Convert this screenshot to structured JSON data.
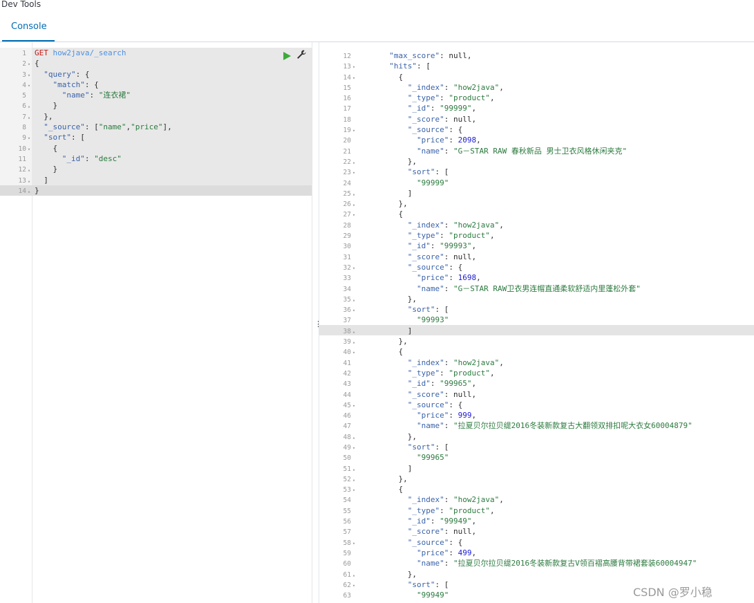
{
  "app": {
    "title": "Dev Tools"
  },
  "tabs": [
    {
      "label": "Console"
    }
  ],
  "request": {
    "lines": [
      {
        "n": "1",
        "fold": "",
        "html": "<span class=\"m\">GET</span> <span class=\"u\">how2java/_search</span>"
      },
      {
        "n": "2",
        "fold": "▾",
        "html": "{"
      },
      {
        "n": "3",
        "fold": "▾",
        "html": "  <span class=\"k\">\"query\"</span>: {"
      },
      {
        "n": "4",
        "fold": "▾",
        "html": "    <span class=\"k\">\"match\"</span>: {"
      },
      {
        "n": "5",
        "fold": "",
        "html": "      <span class=\"k\">\"name\"</span>: <span class=\"s\">\"连衣裙\"</span>"
      },
      {
        "n": "6",
        "fold": "▴",
        "html": "    }"
      },
      {
        "n": "7",
        "fold": "▴",
        "html": "  },"
      },
      {
        "n": "8",
        "fold": "",
        "html": "  <span class=\"k\">\"_source\"</span>: [<span class=\"s\">\"name\"</span>,<span class=\"s\">\"price\"</span>],"
      },
      {
        "n": "9",
        "fold": "▾",
        "html": "  <span class=\"k\">\"sort\"</span>: ["
      },
      {
        "n": "10",
        "fold": "▾",
        "html": "    {"
      },
      {
        "n": "11",
        "fold": "",
        "html": "      <span class=\"k\">\"_id\"</span>: <span class=\"s\">\"desc\"</span>"
      },
      {
        "n": "12",
        "fold": "▴",
        "html": "    }"
      },
      {
        "n": "13",
        "fold": "▴",
        "html": "  ]"
      },
      {
        "n": "14",
        "fold": "▴",
        "html": "}"
      }
    ]
  },
  "response": {
    "lines": [
      {
        "n": "12",
        "fold": "",
        "html": "  <span class=\"k\">\"max_score\"</span>: null,"
      },
      {
        "n": "13",
        "fold": "▾",
        "html": "  <span class=\"k\">\"hits\"</span>: ["
      },
      {
        "n": "14",
        "fold": "▾",
        "html": "    {"
      },
      {
        "n": "15",
        "fold": "",
        "html": "      <span class=\"k\">\"_index\"</span>: <span class=\"s\">\"how2java\"</span>,"
      },
      {
        "n": "16",
        "fold": "",
        "html": "      <span class=\"k\">\"_type\"</span>: <span class=\"s\">\"product\"</span>,"
      },
      {
        "n": "17",
        "fold": "",
        "html": "      <span class=\"k\">\"_id\"</span>: <span class=\"s\">\"99999\"</span>,"
      },
      {
        "n": "18",
        "fold": "",
        "html": "      <span class=\"k\">\"_score\"</span>: null,"
      },
      {
        "n": "19",
        "fold": "▾",
        "html": "      <span class=\"k\">\"_source\"</span>: {"
      },
      {
        "n": "20",
        "fold": "",
        "html": "        <span class=\"k\">\"price\"</span>: <span class=\"n\">2098</span>,"
      },
      {
        "n": "21",
        "fold": "",
        "html": "        <span class=\"k\">\"name\"</span>: <span class=\"s\">\"G－STAR RAW 春秋新品 男士卫衣风格休闲夹克\"</span>"
      },
      {
        "n": "22",
        "fold": "▴",
        "html": "      },"
      },
      {
        "n": "23",
        "fold": "▾",
        "html": "      <span class=\"k\">\"sort\"</span>: ["
      },
      {
        "n": "24",
        "fold": "",
        "html": "        <span class=\"s\">\"99999\"</span>"
      },
      {
        "n": "25",
        "fold": "▴",
        "html": "      ]"
      },
      {
        "n": "26",
        "fold": "▴",
        "html": "    },"
      },
      {
        "n": "27",
        "fold": "▾",
        "html": "    {"
      },
      {
        "n": "28",
        "fold": "",
        "html": "      <span class=\"k\">\"_index\"</span>: <span class=\"s\">\"how2java\"</span>,"
      },
      {
        "n": "29",
        "fold": "",
        "html": "      <span class=\"k\">\"_type\"</span>: <span class=\"s\">\"product\"</span>,"
      },
      {
        "n": "30",
        "fold": "",
        "html": "      <span class=\"k\">\"_id\"</span>: <span class=\"s\">\"99993\"</span>,"
      },
      {
        "n": "31",
        "fold": "",
        "html": "      <span class=\"k\">\"_score\"</span>: null,"
      },
      {
        "n": "32",
        "fold": "▾",
        "html": "      <span class=\"k\">\"_source\"</span>: {"
      },
      {
        "n": "33",
        "fold": "",
        "html": "        <span class=\"k\">\"price\"</span>: <span class=\"n\">1698</span>,"
      },
      {
        "n": "34",
        "fold": "",
        "html": "        <span class=\"k\">\"name\"</span>: <span class=\"s\">\"G－STAR RAW卫衣男连帽直通柔软舒适内里蓬松外套\"</span>"
      },
      {
        "n": "35",
        "fold": "▴",
        "html": "      },"
      },
      {
        "n": "36",
        "fold": "▾",
        "html": "      <span class=\"k\">\"sort\"</span>: ["
      },
      {
        "n": "37",
        "fold": "",
        "html": "        <span class=\"s\">\"99993\"</span>"
      },
      {
        "n": "38",
        "fold": "▴",
        "html": "      ]"
      },
      {
        "n": "39",
        "fold": "▴",
        "html": "    },"
      },
      {
        "n": "40",
        "fold": "▾",
        "html": "    {"
      },
      {
        "n": "41",
        "fold": "",
        "html": "      <span class=\"k\">\"_index\"</span>: <span class=\"s\">\"how2java\"</span>,"
      },
      {
        "n": "42",
        "fold": "",
        "html": "      <span class=\"k\">\"_type\"</span>: <span class=\"s\">\"product\"</span>,"
      },
      {
        "n": "43",
        "fold": "",
        "html": "      <span class=\"k\">\"_id\"</span>: <span class=\"s\">\"99965\"</span>,"
      },
      {
        "n": "44",
        "fold": "",
        "html": "      <span class=\"k\">\"_score\"</span>: null,"
      },
      {
        "n": "45",
        "fold": "▾",
        "html": "      <span class=\"k\">\"_source\"</span>: {"
      },
      {
        "n": "46",
        "fold": "",
        "html": "        <span class=\"k\">\"price\"</span>: <span class=\"n\">999</span>,"
      },
      {
        "n": "47",
        "fold": "",
        "html": "        <span class=\"k\">\"name\"</span>: <span class=\"s\">\"拉夏贝尔拉贝缇2016冬装新款复古大翻领双排扣呢大衣女60004879\"</span>"
      },
      {
        "n": "48",
        "fold": "▴",
        "html": "      },"
      },
      {
        "n": "49",
        "fold": "▾",
        "html": "      <span class=\"k\">\"sort\"</span>: ["
      },
      {
        "n": "50",
        "fold": "",
        "html": "        <span class=\"s\">\"99965\"</span>"
      },
      {
        "n": "51",
        "fold": "▴",
        "html": "      ]"
      },
      {
        "n": "52",
        "fold": "▴",
        "html": "    },"
      },
      {
        "n": "53",
        "fold": "▾",
        "html": "    {"
      },
      {
        "n": "54",
        "fold": "",
        "html": "      <span class=\"k\">\"_index\"</span>: <span class=\"s\">\"how2java\"</span>,"
      },
      {
        "n": "55",
        "fold": "",
        "html": "      <span class=\"k\">\"_type\"</span>: <span class=\"s\">\"product\"</span>,"
      },
      {
        "n": "56",
        "fold": "",
        "html": "      <span class=\"k\">\"_id\"</span>: <span class=\"s\">\"99949\"</span>,"
      },
      {
        "n": "57",
        "fold": "",
        "html": "      <span class=\"k\">\"_score\"</span>: null,"
      },
      {
        "n": "58",
        "fold": "▾",
        "html": "      <span class=\"k\">\"_source\"</span>: {"
      },
      {
        "n": "59",
        "fold": "",
        "html": "        <span class=\"k\">\"price\"</span>: <span class=\"n\">499</span>,"
      },
      {
        "n": "60",
        "fold": "",
        "html": "        <span class=\"k\">\"name\"</span>: <span class=\"s\">\"拉夏贝尔拉贝缇2016冬装新款复古V领百褶高腰背带裙套装60004947\"</span>"
      },
      {
        "n": "61",
        "fold": "▴",
        "html": "      },"
      },
      {
        "n": "62",
        "fold": "▾",
        "html": "      <span class=\"k\">\"sort\"</span>: ["
      },
      {
        "n": "63",
        "fold": "",
        "html": "        <span class=\"s\">\"99949\"</span>"
      }
    ]
  },
  "watermark": "CSDN @罗小稳",
  "icons": {
    "run": "play-icon",
    "settings": "wrench-icon",
    "resize": "vertical-dots-icon"
  }
}
